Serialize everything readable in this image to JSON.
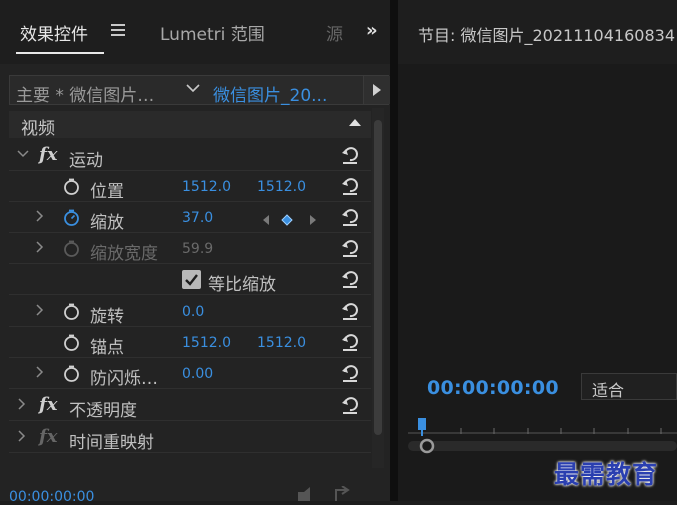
{
  "left_panel": {
    "tabs": [
      {
        "label": "效果控件"
      },
      {
        "label": "Lumetri 范围"
      },
      {
        "label": "源"
      }
    ],
    "more_tabs": "»",
    "clip_bar": {
      "master": "主要 * 微信图片…",
      "sequence": "微信图片_20..."
    },
    "section_title": "视频",
    "effects": {
      "motion": {
        "label": "运动",
        "position": {
          "label": "位置",
          "x": "1512.0",
          "y": "1512.0"
        },
        "scale": {
          "label": "缩放",
          "value": "37.0"
        },
        "scale_width": {
          "label": "缩放宽度",
          "value": "59.9"
        },
        "uniform_scale": {
          "label": "等比缩放",
          "checked": true
        },
        "rotation": {
          "label": "旋转",
          "value": "0.0"
        },
        "anchor": {
          "label": "锚点",
          "x": "1512.0",
          "y": "1512.0"
        },
        "anti_flicker": {
          "label": "防闪烁…",
          "value": "0.00"
        }
      },
      "opacity": {
        "label": "不透明度"
      },
      "time_remap": {
        "label": "时间重映射"
      }
    },
    "timecode": "00:00:00:00"
  },
  "program_monitor": {
    "title": "节目: 微信图片_20211104160834",
    "timecode": "00:00:00:00",
    "fit": "适合",
    "accent": "#3a8fe0"
  },
  "watermark": "最需教育"
}
